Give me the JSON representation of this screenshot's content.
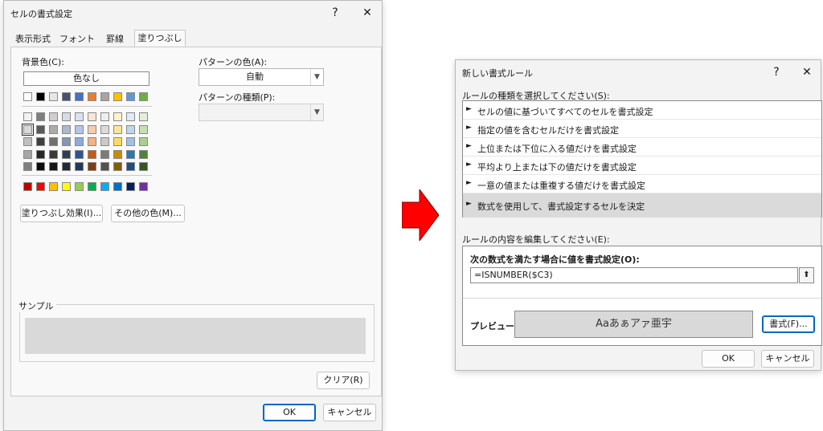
{
  "left_dialog": {
    "title": "セルの書式設定",
    "help": "?",
    "close": "✕",
    "tabs": [
      {
        "label": "表示形式"
      },
      {
        "label": "フォント"
      },
      {
        "label": "罫線"
      },
      {
        "label": "塗りつぶし"
      }
    ],
    "bg_color_label": "背景色(C):",
    "no_color_button": "色なし",
    "pattern_color_label": "パターンの色(A):",
    "pattern_color_value": "自動",
    "pattern_type_label": "パターンの種類(P):",
    "pattern_type_value": "",
    "fill_effects_button": "塗りつぶし効果(I)...",
    "more_colors_button": "その他の色(M)...",
    "sample_label": "サンプル",
    "clear_button": "クリア(R)",
    "ok_button": "OK",
    "cancel_button": "キャンセル",
    "palette_top": [
      "#ffffff",
      "#000000",
      "#e7e6e6",
      "#44546a",
      "#4472c4",
      "#ed7d31",
      "#a5a5a5",
      "#ffc000",
      "#5b9bd5",
      "#70ad47"
    ],
    "palette_tints": [
      [
        "#f2f2f2",
        "#7f7f7f",
        "#d0cece",
        "#d6dce4",
        "#d9e2f3",
        "#fbe5d5",
        "#ededed",
        "#fff2cc",
        "#deebf6",
        "#e2efd9"
      ],
      [
        "#d9d9d9",
        "#595959",
        "#aeabab",
        "#adb9ca",
        "#b4c6e7",
        "#f7cbac",
        "#dbdbdb",
        "#fee599",
        "#bdd7ee",
        "#c5e0b3"
      ],
      [
        "#bfbfbf",
        "#3f3f3f",
        "#757070",
        "#8496b0",
        "#8eaadb",
        "#f4b183",
        "#c9c9c9",
        "#ffd965",
        "#9cc3e5",
        "#a8d08d"
      ],
      [
        "#a6a6a6",
        "#262626",
        "#3a3838",
        "#323f4f",
        "#2f5496",
        "#c55a11",
        "#7b7b7b",
        "#bf9000",
        "#2e75b5",
        "#538135"
      ],
      [
        "#7f7f7f",
        "#0c0c0c",
        "#171616",
        "#222a35",
        "#1f3864",
        "#833c0b",
        "#525252",
        "#7f6000",
        "#1e4e79",
        "#375623"
      ]
    ],
    "palette_standard": [
      "#c00000",
      "#ff0000",
      "#ffc000",
      "#ffff00",
      "#92d050",
      "#00b050",
      "#00b0f0",
      "#0070c0",
      "#002060",
      "#7030a0"
    ],
    "sample_color": "#d9d9d9"
  },
  "arrow_color": "#ff0000",
  "right_dialog": {
    "title": "新しい書式ルール",
    "help": "?",
    "close": "✕",
    "rule_type_label": "ルールの種類を選択してください(S):",
    "rule_types": [
      {
        "label": "セルの値に基づいてすべてのセルを書式設定"
      },
      {
        "label": "指定の値を含むセルだけを書式設定"
      },
      {
        "label": "上位または下位に入る値だけを書式設定"
      },
      {
        "label": "平均より上または下の値だけを書式設定"
      },
      {
        "label": "一意の値または重複する値だけを書式設定"
      },
      {
        "label": "数式を使用して、書式設定するセルを決定"
      }
    ],
    "bullet": "►",
    "edit_label": "ルールの内容を編集してください(E):",
    "formula_heading": "次の数式を満たす場合に値を書式設定(O):",
    "formula_value": "=ISNUMBER($C3)",
    "collapse_icon": "⬆",
    "preview_label": "プレビュー:",
    "preview_text": "Aaあぁアァ亜宇",
    "format_button": "書式(F)...",
    "ok_button": "OK",
    "cancel_button": "キャンセル"
  }
}
